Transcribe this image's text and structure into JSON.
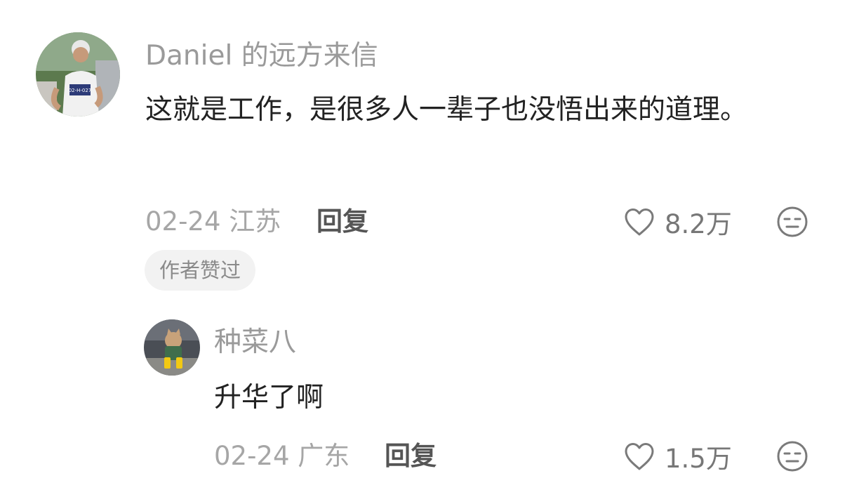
{
  "comment": {
    "username": "Daniel 的远方来信",
    "text": "这就是工作，是很多人一辈子也没悟出来的道理。",
    "date": "02-24",
    "location": "江苏",
    "reply_label": "回复",
    "like_count": "8.2万",
    "badge": "作者赞过",
    "avatar_bib": "02-H-027"
  },
  "reply": {
    "username": "种菜八",
    "text": "升华了啊",
    "date": "02-24",
    "location": "广东",
    "reply_label": "回复",
    "like_count": "1.5万"
  },
  "icons": {
    "like": "heart-outline-icon",
    "dislike": "neutral-face-icon"
  },
  "colors": {
    "username": "#9a9a9a",
    "text": "#222222",
    "meta": "#a6a6a6",
    "reply": "#555555",
    "badge_bg": "#f2f2f2"
  }
}
